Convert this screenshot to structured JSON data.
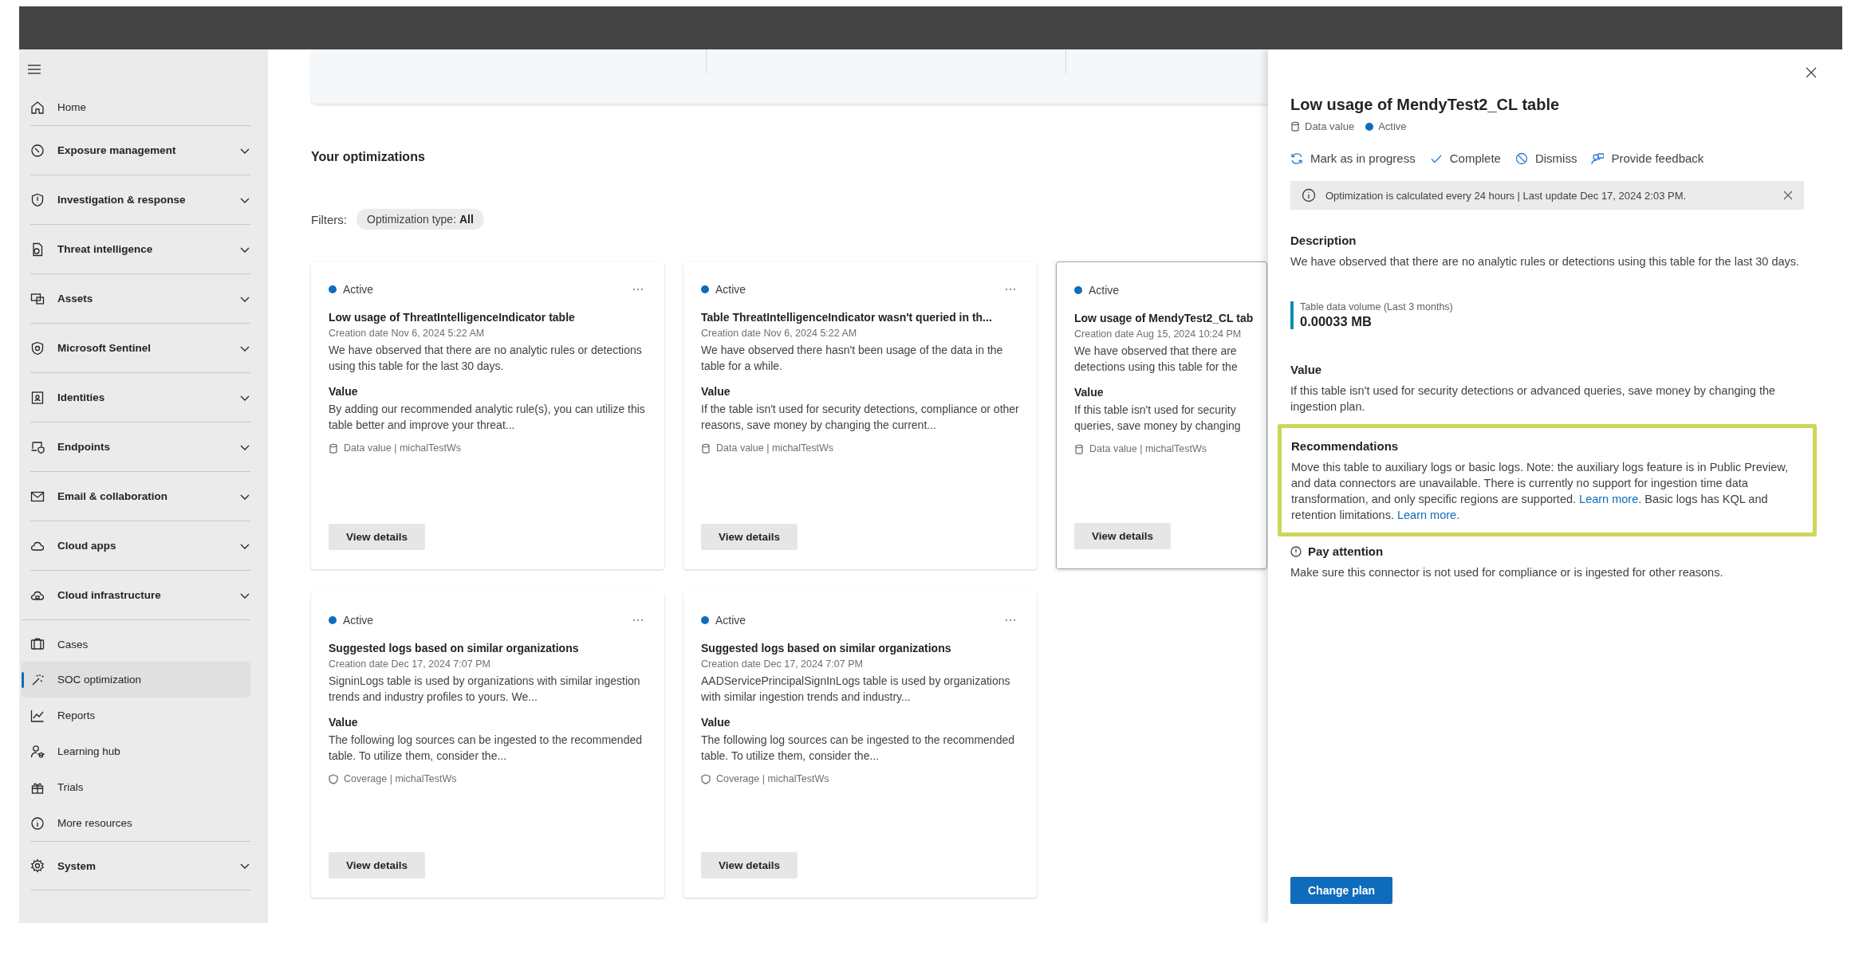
{
  "sidebar": {
    "items": [
      {
        "kind": "link",
        "label": "Home",
        "selected": false
      },
      {
        "kind": "section",
        "label": "Exposure management",
        "expanded": false
      },
      {
        "kind": "section",
        "label": "Investigation & response",
        "expanded": false
      },
      {
        "kind": "section",
        "label": "Threat intelligence",
        "expanded": false
      },
      {
        "kind": "section",
        "label": "Assets",
        "expanded": false
      },
      {
        "kind": "section",
        "label": "Microsoft Sentinel",
        "expanded": false
      },
      {
        "kind": "section",
        "label": "Identities",
        "expanded": false
      },
      {
        "kind": "section",
        "label": "Endpoints",
        "expanded": false
      },
      {
        "kind": "section",
        "label": "Email & collaboration",
        "expanded": false
      },
      {
        "kind": "section",
        "label": "Cloud apps",
        "expanded": false
      },
      {
        "kind": "section",
        "label": "Cloud infrastructure",
        "expanded": false
      },
      {
        "kind": "link",
        "label": "Cases",
        "selected": false
      },
      {
        "kind": "link",
        "label": "SOC optimization",
        "selected": true
      },
      {
        "kind": "link",
        "label": "Reports",
        "selected": false
      },
      {
        "kind": "link",
        "label": "Learning hub",
        "selected": false
      },
      {
        "kind": "link",
        "label": "Trials",
        "selected": false
      },
      {
        "kind": "link",
        "label": "More resources",
        "selected": false
      },
      {
        "kind": "section",
        "label": "System",
        "expanded": false
      }
    ]
  },
  "optimizations": {
    "heading": "Your optimizations",
    "filters_label": "Filters:",
    "filter_chip": {
      "name": "Optimization type:",
      "value": "All"
    },
    "cards": [
      {
        "kind": "data",
        "selected": false,
        "status": "Active",
        "title": "Low usage of ThreatIntelligenceIndicator table",
        "creation_label": "Creation date",
        "creation_date": "Nov 6, 2024 5:22 AM",
        "description": "We have observed that there are no analytic rules or detections using this table for the last 30 days.",
        "value_heading": "Value",
        "value_text": "By adding our recommended analytic rule(s), you can utilize this table better and improve your threat...",
        "meta": "Data value | michalTestWs",
        "button": "View details"
      },
      {
        "kind": "data",
        "selected": false,
        "status": "Active",
        "title": "Table ThreatIntelligenceIndicator wasn't queried in th...",
        "creation_label": "Creation date",
        "creation_date": "Nov 6, 2024 5:22 AM",
        "description": "We have observed there hasn't been usage of the data in the table for a while.",
        "value_heading": "Value",
        "value_text": "If the table isn't used for security detections, compliance or other reasons, save money by changing the current...",
        "meta": "Data value | michalTestWs",
        "button": "View details"
      },
      {
        "kind": "data",
        "selected": true,
        "status": "Active",
        "title": "Low usage of MendyTest2_CL tab",
        "creation_label": "Creation date",
        "creation_date": "Aug 15, 2024 10:24 PM",
        "description": "We have observed that there are detections using this table for the",
        "value_heading": "Value",
        "value_text": "If this table isn't used for security queries, save money by changing",
        "meta": "Data value | michalTestWs",
        "button": "View details"
      },
      {
        "kind": "coverage",
        "selected": false,
        "status": "Active",
        "title": "Suggested logs based on similar organizations",
        "creation_label": "Creation date",
        "creation_date": "Dec 17, 2024 7:07 PM",
        "description": "SigninLogs table is used by organizations with similar ingestion trends and industry profiles to yours. We...",
        "value_heading": "Value",
        "value_text": "The following log sources can be ingested to the recommended table. To utilize them, consider the...",
        "meta": "Coverage | michalTestWs",
        "button": "View details"
      },
      {
        "kind": "coverage",
        "selected": false,
        "status": "Active",
        "title": "Suggested logs based on similar organizations",
        "creation_label": "Creation date",
        "creation_date": "Dec 17, 2024 7:07 PM",
        "description": "AADServicePrincipalSignInLogs table is used by organizations with similar ingestion trends and industry...",
        "value_heading": "Value",
        "value_text": "The following log sources can be ingested to the recommended table. To utilize them, consider the...",
        "meta": "Coverage | michalTestWs",
        "button": "View details"
      }
    ]
  },
  "panel": {
    "title": "Low usage of MendyTest2_CL table",
    "tags": [
      {
        "kind": "data",
        "label": "Data value"
      },
      {
        "kind": "status",
        "label": "Active"
      }
    ],
    "actions": [
      "Mark as in progress",
      "Complete",
      "Dismiss",
      "Provide feedback"
    ],
    "banner": "Optimization is calculated every 24 hours | Last update Dec 17, 2024 2:03 PM.",
    "description": {
      "heading": "Description",
      "text": "We have observed that there are no analytic rules or detections using this table for the last 30 days."
    },
    "metric": {
      "label": "Table data volume (Last 3 months)",
      "value": "0.00033 MB"
    },
    "value": {
      "heading": "Value",
      "text": "If this table isn't used for security detections or advanced queries, save money by changing the ingestion plan."
    },
    "recommendations": {
      "heading": "Recommendations",
      "highlighted": true,
      "segments": [
        {
          "kind": "text",
          "text": "Move this table to auxiliary logs or basic logs. Note: the auxiliary logs feature is in Public Preview, and data connectors are unavailable. There is currently no support for ingestion time data transformation, and only specific regions are supported. "
        },
        {
          "kind": "link",
          "text": "Learn more"
        },
        {
          "kind": "text",
          "text": ". Basic logs has KQL and retention limitations. "
        },
        {
          "kind": "link",
          "text": "Learn more"
        },
        {
          "kind": "text",
          "text": "."
        }
      ]
    },
    "attention": {
      "heading": "Pay attention",
      "text": "Make sure this connector is not used for compliance or is ingested for other reasons."
    },
    "primary_button": "Change plan"
  }
}
